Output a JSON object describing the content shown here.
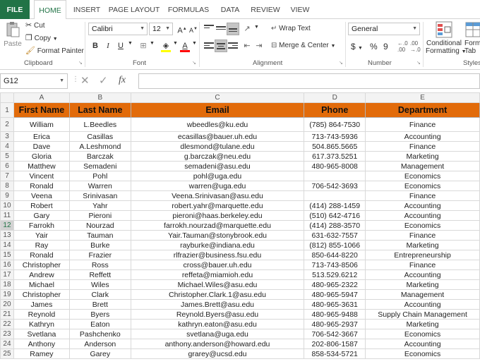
{
  "tabs": [
    "FILE",
    "HOME",
    "INSERT",
    "PAGE LAYOUT",
    "FORMULAS",
    "DATA",
    "REVIEW",
    "VIEW"
  ],
  "active_tab": "HOME",
  "clipboard": {
    "paste": "Paste",
    "cut": "Cut",
    "copy": "Copy",
    "format_painter": "Format Painter",
    "group": "Clipboard"
  },
  "font": {
    "name": "Calibri",
    "size": "12",
    "bold": "B",
    "italic": "I",
    "underline": "U",
    "grow": "A",
    "shrink": "A",
    "font_color": "A",
    "group": "Font"
  },
  "alignment": {
    "wrap_text": "Wrap Text",
    "merge_center": "Merge & Center",
    "group": "Alignment"
  },
  "number": {
    "format": "General",
    "currency": "$",
    "percent": "%",
    "comma": "9",
    "group": "Number"
  },
  "styles": {
    "conditional_line1": "Conditional",
    "conditional_line2": "Formatting",
    "format_as_line1": "Form",
    "format_as_line2": "Tab",
    "group": "Styles"
  },
  "formula_bar": {
    "name_box": "G12",
    "fx": "fx",
    "value": ""
  },
  "columns": [
    "A",
    "B",
    "C",
    "D",
    "E"
  ],
  "headers": [
    "First Name",
    "Last Name",
    "Email",
    "Phone",
    "Department"
  ],
  "rows": [
    [
      "William",
      "L.Beedles",
      "wbeedles@ku.edu",
      "(785) 864-7530",
      "Finance"
    ],
    [
      "Erica",
      "Casillas",
      "ecasillas@bauer.uh.edu",
      "713-743-5936",
      "Accounting"
    ],
    [
      "Dave",
      "A.Leshmond",
      "dlesmond@tulane.edu",
      "504.865.5665",
      "Finance"
    ],
    [
      "Gloria",
      "Barczak",
      "g.barczak@neu.edu",
      "617.373.5251",
      "Marketing"
    ],
    [
      "Matthew",
      "Semadeni",
      "semadeni@asu.edu",
      "480-965-8008",
      "Management"
    ],
    [
      "Vincent",
      "Pohl",
      "pohl@uga.edu",
      "",
      "Economics"
    ],
    [
      "Ronald",
      "Warren",
      "warren@uga.edu",
      "706-542-3693",
      "Economics"
    ],
    [
      "Veena",
      "Srinivasan",
      "Veena.Srinivasan@asu.edu",
      "",
      "Finance"
    ],
    [
      "Robert",
      "Yahr",
      "robert.yahr@marquette.edu",
      "(414) 288-1459",
      "Accounting"
    ],
    [
      "Gary",
      "Pieroni",
      "pieroni@haas.berkeley.edu",
      "(510) 642-4716",
      "Accounting"
    ],
    [
      "Farrokh",
      "Nourzad",
      "farrokh.nourzad@marquette.edu",
      "(414) 288-3570",
      "Economics"
    ],
    [
      "Yair",
      "Tauman",
      "Yair.Tauman@stonybrook.edu",
      "631-632-7557",
      "Finance"
    ],
    [
      "Ray",
      "Burke",
      "rayburke@indiana.edu",
      "(812) 855-1066",
      "Marketing"
    ],
    [
      "Ronald",
      "Frazier",
      "rlfrazier@business.fsu.edu",
      "850-644-8220",
      "Entrepreneurship"
    ],
    [
      "Christopher",
      "Ross",
      "cross@bauer.uh.edu",
      "713-743-8506",
      "Finance"
    ],
    [
      "Andrew",
      "Reffett",
      "reffeta@miamioh.edu",
      "513.529.6212",
      "Accounting"
    ],
    [
      "Michael",
      "Wiles",
      "Michael.Wiles@asu.edu",
      "480-965-2322",
      "Marketing"
    ],
    [
      "Christopher",
      "Clark",
      "Christopher.Clark.1@asu.edu",
      "480-965-5947",
      "Management"
    ],
    [
      "James",
      "Brett",
      "James.Brett@asu.edu",
      "480-965-3631",
      "Accounting"
    ],
    [
      "Reynold",
      "Byers",
      "Reynold.Byers@asu.edu",
      "480-965-9488",
      "Supply Chain Management"
    ],
    [
      "Kathryn",
      "Eaton",
      "kathryn.eaton@asu.edu",
      "480-965-2937",
      "Marketing"
    ],
    [
      "Svetlana",
      "Pashchenko",
      "svetlana@uga.edu",
      "706-542-3667",
      "Economics"
    ],
    [
      "Anthony",
      "Anderson",
      "anthony.anderson@howard.edu",
      "202-806-1587",
      "Accounting"
    ],
    [
      "Ramey",
      "Garey",
      "grarey@ucsd.edu",
      "858-534-5721",
      "Economics"
    ]
  ],
  "row_numbers": [
    "1",
    "2",
    "3",
    "4",
    "5",
    "6",
    "7",
    "8",
    "9",
    "10",
    "11",
    "12",
    "13",
    "14",
    "15",
    "16",
    "17",
    "18",
    "19",
    "20",
    "21",
    "22",
    "23",
    "24",
    "25"
  ],
  "active_row": "12",
  "colors": {
    "excel_green": "#217346",
    "header_fill": "#e26b0a"
  }
}
